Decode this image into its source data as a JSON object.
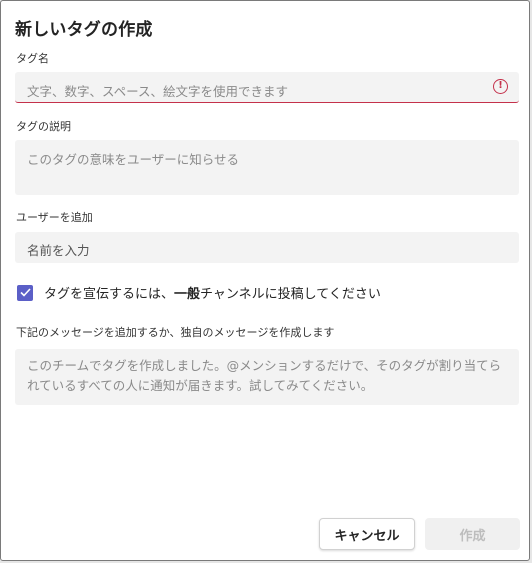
{
  "dialog": {
    "title": "新しいタグの作成",
    "tag_name": {
      "label": "タグ名",
      "placeholder": "文字、数字、スペース、絵文字を使用できます",
      "value": "",
      "error_icon": "error-circle-icon"
    },
    "tag_description": {
      "label": "タグの説明",
      "placeholder": "このタグの意味をユーザーに知らせる",
      "value": ""
    },
    "add_users": {
      "label": "ユーザーを追加",
      "placeholder": "名前を入力",
      "value": ""
    },
    "announce": {
      "checked": true,
      "label_prefix": "タグを宣伝するには、",
      "label_bold": "一般",
      "label_suffix": "チャンネルに投稿してください"
    },
    "message": {
      "label": "下記のメッセージを追加するか、独自のメッセージを作成します",
      "value": "このチームでタグを作成しました。@メンションするだけで、そのタグが割り当てられているすべての人に通知が届きます。試してみてください。"
    },
    "buttons": {
      "cancel": "キャンセル",
      "create": "作成"
    }
  },
  "colors": {
    "accent": "#5b5fc7",
    "error": "#c4314b",
    "field_bg": "#f3f3f3"
  }
}
